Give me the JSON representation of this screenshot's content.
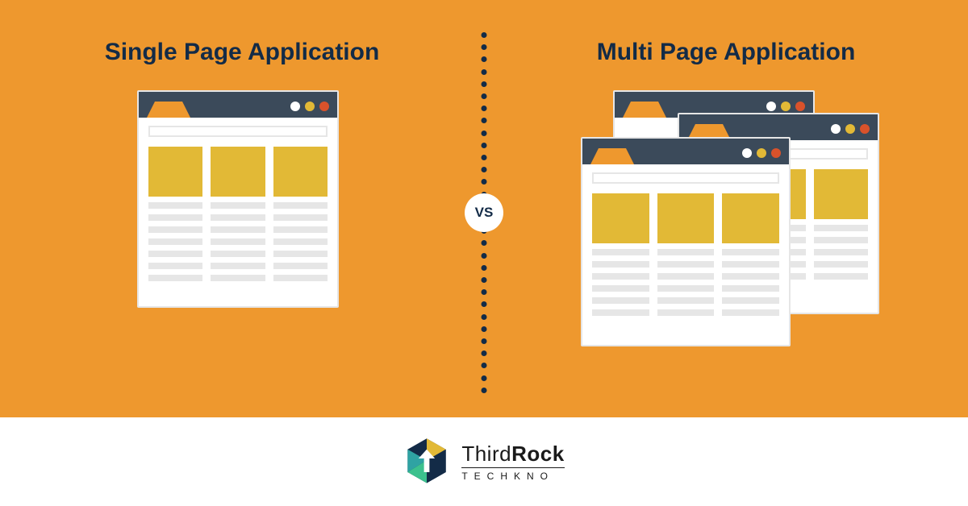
{
  "left": {
    "title": "Single Page Application"
  },
  "right": {
    "title": "Multi Page Application"
  },
  "divider_label": "VS",
  "brand": {
    "word1": "Third",
    "word2": "Rock",
    "sub": "TECHKNO"
  }
}
